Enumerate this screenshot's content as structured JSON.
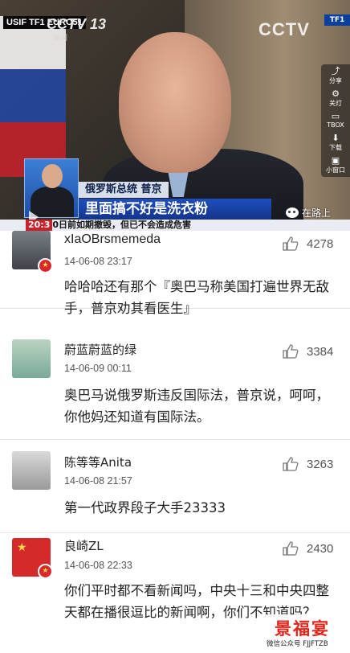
{
  "video": {
    "channel_logo": "USIF TF1 EURO51",
    "cctv_top_left": "CCTV 13",
    "cctv_sub": "新闻",
    "cctv_top_right": "CCTV",
    "tf1": "TF1",
    "side_actions": [
      {
        "icon": "share-icon",
        "label": "分享"
      },
      {
        "icon": "settings-icon",
        "label": "关灯"
      },
      {
        "icon": "tv-icon",
        "label": "TBOX"
      },
      {
        "icon": "download-icon",
        "label": "下载"
      },
      {
        "icon": "mini-window-icon",
        "label": "小窗口"
      }
    ],
    "caption_top": "俄罗斯总统 普京",
    "caption_main": "里面搞不好是洗衣粉",
    "ticker_time": "20:3",
    "ticker_text": "0日前如期撤毁，但已不会造成危害",
    "watermark": "在路上"
  },
  "comments": [
    {
      "username": "xIaOBrsmemeda",
      "timestamp": "14-06-08 23:17",
      "likes": "4278",
      "text": "哈哈哈还有那个『奥巴马称美国打遍世界无敌手，普京劝其看医生』"
    },
    {
      "username": "蔚蓝蔚蓝的绿",
      "timestamp": "14-06-09 00:11",
      "likes": "3384",
      "text": "奥巴马说俄罗斯违反国际法，普京说，呵呵，你他妈还知道有国际法。"
    },
    {
      "username": "陈等等Anita",
      "timestamp": "14-06-08 21:57",
      "likes": "3263",
      "text": "第一代政界段子大手23333"
    },
    {
      "username": "良崎ZL",
      "timestamp": "14-06-08 22:33",
      "likes": "2430",
      "text": "你们平时都不看新闻吗，中央十三和中央四整天都在播很逗比的新闻啊，你们不知道吗？"
    }
  ],
  "watermark": {
    "title": "景福宴",
    "subtitle": "微信公众号 FJJFTZB"
  }
}
